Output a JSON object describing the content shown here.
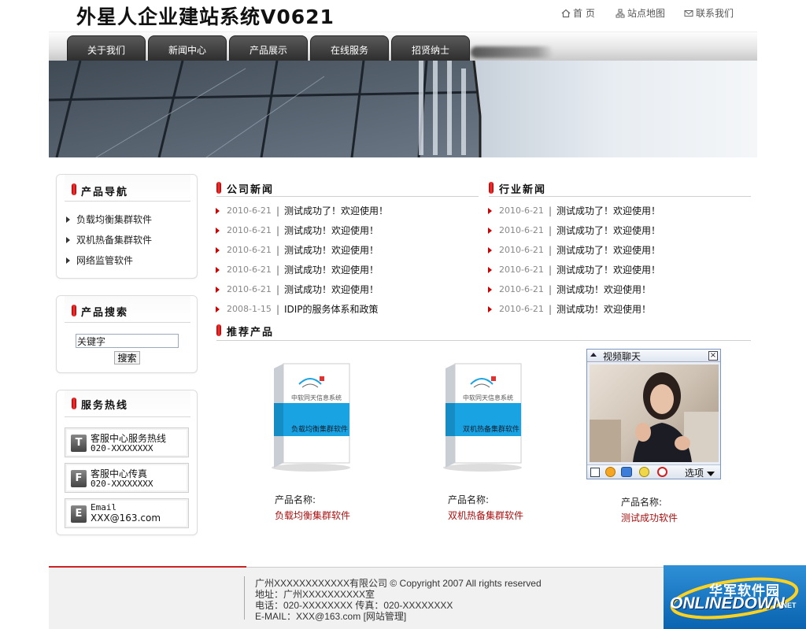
{
  "header": {
    "site_title": "外星人企业建站系统V0621",
    "links": [
      {
        "icon": "home-icon",
        "label": "首 页"
      },
      {
        "icon": "sitemap-icon",
        "label": "站点地图"
      },
      {
        "icon": "mail-icon",
        "label": "联系我们"
      }
    ]
  },
  "nav": {
    "tabs": [
      "关于我们",
      "新闻中心",
      "产品展示",
      "在线服务",
      "招贤纳士"
    ]
  },
  "sidebar": {
    "product_nav": {
      "title": "产品导航",
      "items": [
        "负载均衡集群软件",
        "双机热备集群软件",
        "网络监管软件"
      ]
    },
    "product_search": {
      "title": "产品搜索",
      "placeholder": "关键字",
      "button": "搜索"
    },
    "service_hotline": {
      "title": "服务热线",
      "entries": [
        {
          "icon_letter": "T",
          "label": "客服中心服务热线",
          "value": "020-XXXXXXXX"
        },
        {
          "icon_letter": "F",
          "label": "客服中心传真",
          "value": "020-XXXXXXXX"
        },
        {
          "icon_letter": "E",
          "label": "Email",
          "value": "XXX@163.com"
        }
      ]
    }
  },
  "company_news": {
    "title": "公司新闻",
    "items": [
      {
        "date": "2010-6-21",
        "title": "测试成功了！欢迎使用！"
      },
      {
        "date": "2010-6-21",
        "title": "测试成功！欢迎使用！"
      },
      {
        "date": "2010-6-21",
        "title": "测试成功！欢迎使用！"
      },
      {
        "date": "2010-6-21",
        "title": "测试成功！欢迎使用！"
      },
      {
        "date": "2010-6-21",
        "title": "测试成功！欢迎使用！"
      },
      {
        "date": "2008-1-15",
        "title": "IDIP的服务体系和政策"
      }
    ]
  },
  "industry_news": {
    "title": "行业新闻",
    "items": [
      {
        "date": "2010-6-21",
        "title": "测试成功了！欢迎使用！"
      },
      {
        "date": "2010-6-21",
        "title": "测试成功了！欢迎使用！"
      },
      {
        "date": "2010-6-21",
        "title": "测试成功了！欢迎使用！"
      },
      {
        "date": "2010-6-21",
        "title": "测试成功了！欢迎使用！"
      },
      {
        "date": "2010-6-21",
        "title": "测试成功！欢迎使用！"
      },
      {
        "date": "2010-6-21",
        "title": "测试成功！欢迎使用！"
      }
    ]
  },
  "recommended": {
    "title": "推荐产品",
    "products": [
      {
        "label": "产品名称:",
        "name": "负载均衡集群软件",
        "box_brand": "中软同天信息系统",
        "box_text": "负载均衡集群软件"
      },
      {
        "label": "产品名称:",
        "name": "双机热备集群软件",
        "box_brand": "中软同天信息系统",
        "box_text": "双机热备集群软件"
      },
      {
        "label": "产品名称:",
        "name": "测试成功软件"
      }
    ]
  },
  "video_chat": {
    "title": "视频聊天",
    "options_label": "选项"
  },
  "footer": {
    "line1": "广州XXXXXXXXXXXX有限公司  © Copyright 2007 All rights reserved",
    "line2": "地址：广州XXXXXXXXXX室",
    "line3": "电话：020-XXXXXXXX  传真：020-XXXXXXXX",
    "line4_prefix": "E-MAIL：XXX@163.com",
    "admin_link": "[网站管理]"
  },
  "watermark": {
    "cn": "华军软件园",
    "en": "ONLINEDOWN",
    "suffix": ".NET"
  },
  "colors": {
    "accent_red": "#cc0000",
    "product_name": "#aa1111",
    "nav_tab": "#3a3a3a"
  }
}
